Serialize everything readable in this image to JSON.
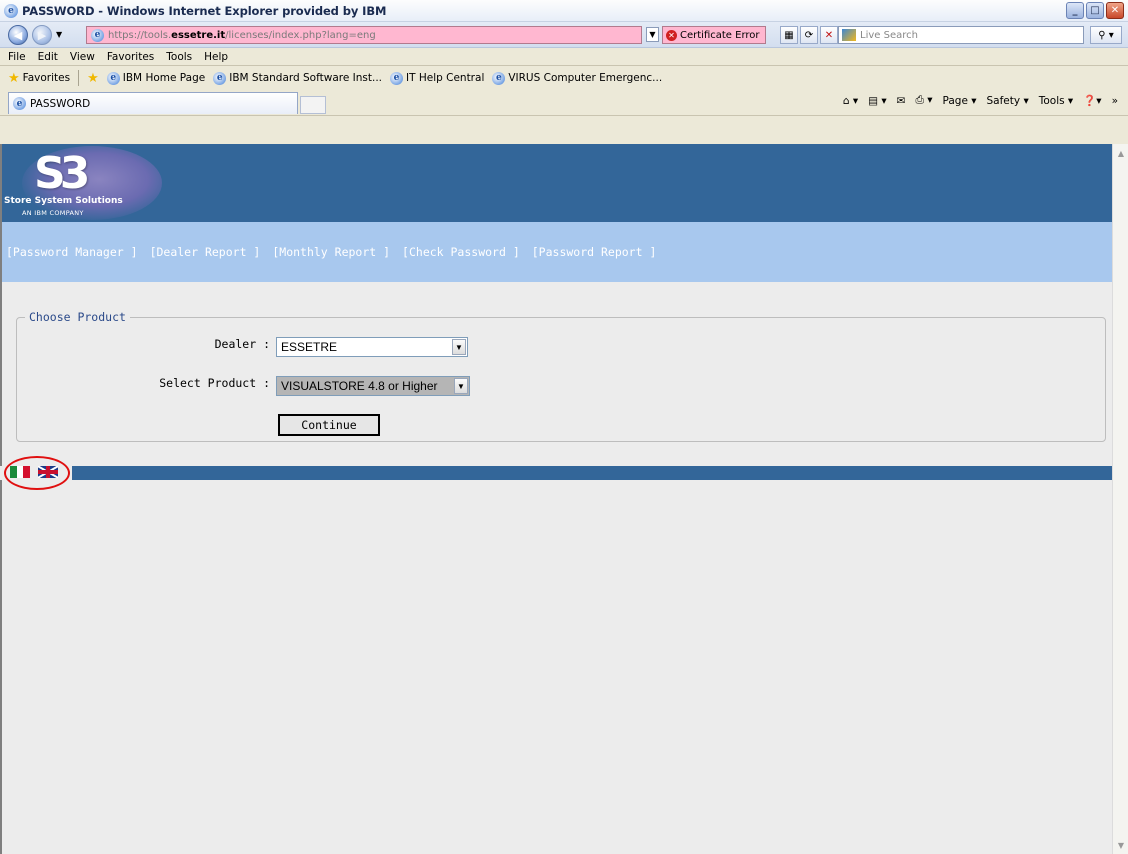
{
  "window": {
    "title": "PASSWORD - Windows Internet Explorer provided by IBM",
    "controls": [
      "minimize",
      "maximize",
      "close"
    ]
  },
  "addressbar": {
    "url_prefix": "https://tools.",
    "url_host": "essetre.it",
    "url_path": "/licenses/index.php?lang=eng",
    "cert_error": "Certificate Error",
    "search_placeholder": "Live Search"
  },
  "menu": {
    "items": [
      "File",
      "Edit",
      "View",
      "Favorites",
      "Tools",
      "Help"
    ]
  },
  "favorites": {
    "label": "Favorites",
    "links": [
      "IBM Home Page",
      "IBM Standard Software Inst...",
      "IT Help Central",
      "VIRUS Computer Emergenc..."
    ]
  },
  "tabs": {
    "active": "PASSWORD"
  },
  "commandbar": {
    "page": "Page",
    "safety": "Safety",
    "tools": "Tools"
  },
  "site": {
    "logo_text": "S3",
    "logo_tagline": "Store System Solutions",
    "logo_sub": "AN IBM COMPANY",
    "nav": [
      "[Password Manager ]",
      "[Dealer Report ]",
      "[Monthly Report ]",
      "[Check Password ]",
      "[Password Report ]"
    ]
  },
  "form": {
    "legend": "Choose Product",
    "dealer_label": "Dealer :",
    "dealer_value": "ESSETRE",
    "product_label": "Select Product :",
    "product_value": "VISUALSTORE 4.8 or Higher",
    "continue_label": "Continue"
  },
  "colors": {
    "header": "#336699",
    "nav_strip": "#a8c8ee",
    "address_error": "#ffb7d0",
    "annotation": "#e01010"
  }
}
